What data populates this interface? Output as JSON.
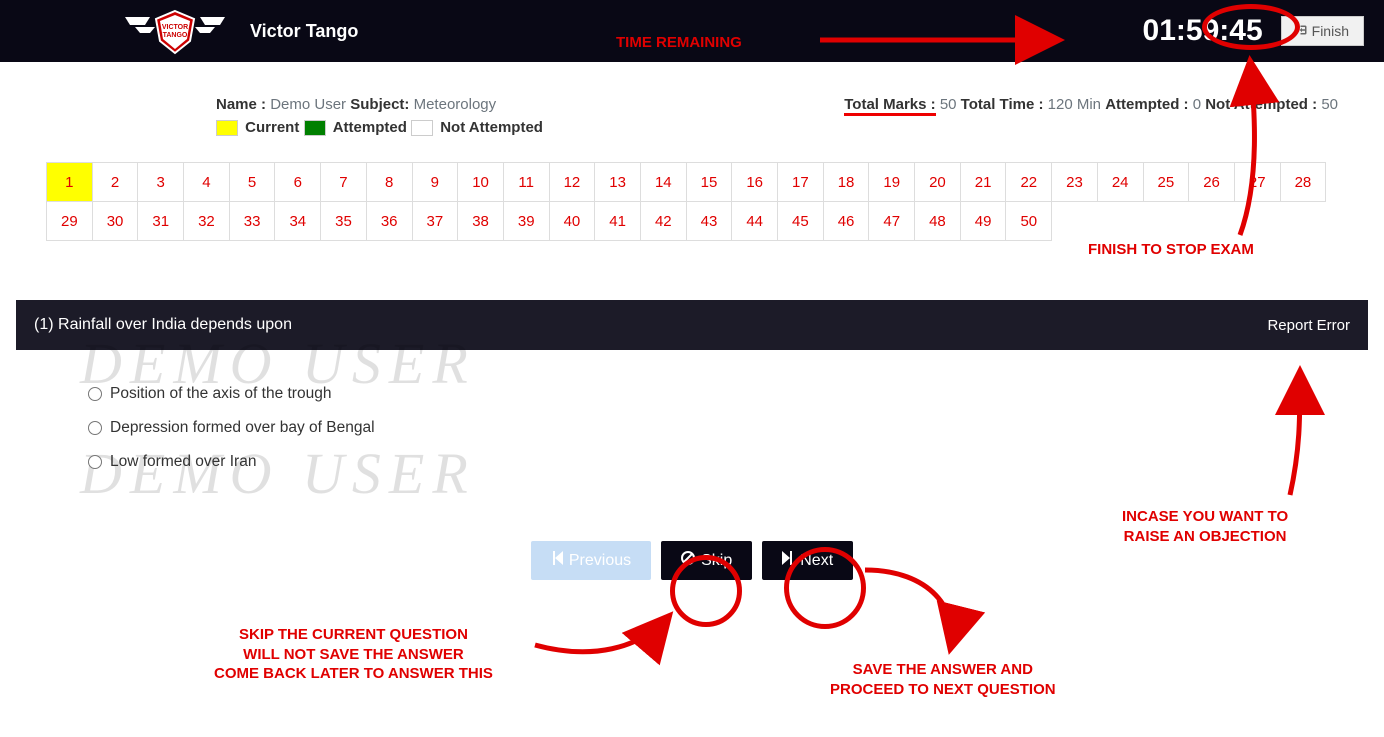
{
  "header": {
    "brand": "Victor Tango",
    "timer": "01:59:45",
    "finish_label": "Finish"
  },
  "info": {
    "name_label": "Name :",
    "name_value": "Demo User",
    "subject_label": "Subject:",
    "subject_value": "Meteorology",
    "total_marks_label": "Total Marks :",
    "total_marks_value": "50",
    "total_time_label": "Total Time :",
    "total_time_value": "120 Min",
    "attempted_label": "Attempted :",
    "attempted_value": "0",
    "not_attempted_label": "Not Attempted :",
    "not_attempted_value": "50"
  },
  "legend": {
    "current": "Current",
    "attempted": "Attempted",
    "not_attempted": "Not Attempted"
  },
  "question_nav": {
    "total": 50,
    "current": 1
  },
  "question": {
    "number_prefix": "(1)",
    "text": "Rainfall over India depends upon",
    "report_label": "Report Error",
    "options": [
      "Position of the axis of the trough",
      "Depression formed over bay of Bengal",
      "Low formed over Iran"
    ]
  },
  "watermark": "DEMO USER",
  "nav_buttons": {
    "previous": "Previous",
    "skip": "Skip",
    "next": "Next"
  },
  "annotations": {
    "time_remaining": "TIME REMAINING",
    "finish_note": "FINISH TO STOP EXAM",
    "objection_note": "INCASE YOU WANT TO\nRAISE AN OBJECTION",
    "skip_note": "SKIP THE CURRENT QUESTION\nWILL NOT SAVE THE ANSWER\nCOME BACK LATER TO ANSWER THIS",
    "next_note": "SAVE THE ANSWER AND\nPROCEED TO NEXT QUESTION"
  }
}
